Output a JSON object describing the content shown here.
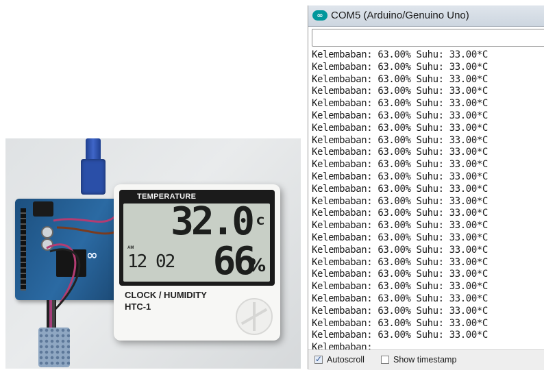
{
  "photo": {
    "display": {
      "header": "TEMPERATURE",
      "temperature": "32.0",
      "temperature_unit": "C",
      "am": "AM",
      "time": "12 02",
      "humidity": "66",
      "humidity_unit": "%",
      "brand_line1": "CLOCK / HUMIDITY",
      "brand_line2": "HTC-1"
    },
    "board_logo": "∞"
  },
  "monitor": {
    "title": "COM5 (Arduino/Genuino Uno)",
    "send_input_value": "",
    "lines": [
      "Kelembaban: 63.00% Suhu: 33.00*C",
      "Kelembaban: 63.00% Suhu: 33.00*C",
      "Kelembaban: 63.00% Suhu: 33.00*C",
      "Kelembaban: 63.00% Suhu: 33.00*C",
      "Kelembaban: 63.00% Suhu: 33.00*C",
      "Kelembaban: 63.00% Suhu: 33.00*C",
      "Kelembaban: 63.00% Suhu: 33.00*C",
      "Kelembaban: 63.00% Suhu: 33.00*C",
      "Kelembaban: 63.00% Suhu: 33.00*C",
      "Kelembaban: 63.00% Suhu: 33.00*C",
      "Kelembaban: 63.00% Suhu: 33.00*C",
      "Kelembaban: 63.00% Suhu: 33.00*C",
      "Kelembaban: 63.00% Suhu: 33.00*C",
      "Kelembaban: 63.00% Suhu: 33.00*C",
      "Kelembaban: 63.00% Suhu: 33.00*C",
      "Kelembaban: 63.00% Suhu: 33.00*C",
      "Kelembaban: 63.00% Suhu: 33.00*C",
      "Kelembaban: 63.00% Suhu: 33.00*C",
      "Kelembaban: 63.00% Suhu: 33.00*C",
      "Kelembaban: 63.00% Suhu: 33.00*C",
      "Kelembaban: 63.00% Suhu: 33.00*C",
      "Kelembaban: 63.00% Suhu: 33.00*C",
      "Kelembaban: 63.00% Suhu: 33.00*C",
      "Kelembaban: 63.00% Suhu: 33.00*C",
      "Kelembaban:"
    ],
    "autoscroll": {
      "label": "Autoscroll",
      "checked": true
    },
    "show_timestamp": {
      "label": "Show timestamp",
      "checked": false
    }
  }
}
